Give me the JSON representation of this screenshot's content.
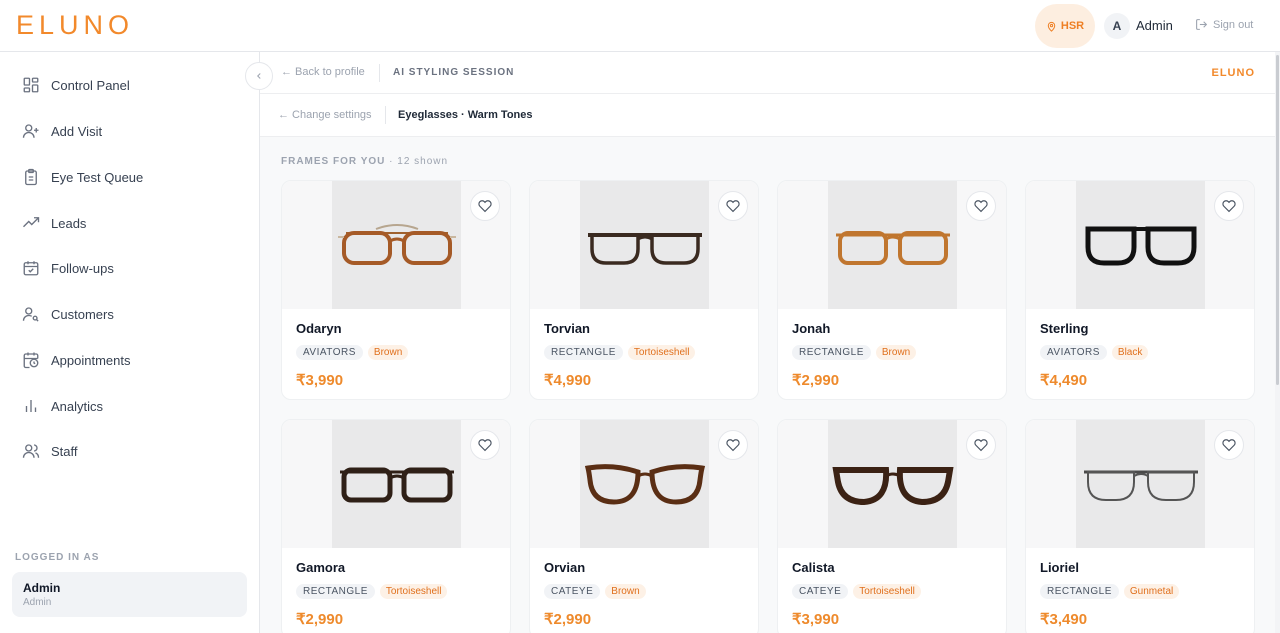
{
  "header": {
    "logo": "ELUNO",
    "location": "HSR",
    "avatar_initial": "A",
    "admin_name": "Admin",
    "signout": "Sign out"
  },
  "sidebar": {
    "items": [
      {
        "label": "Control Panel",
        "icon": "grid-icon"
      },
      {
        "label": "Add Visit",
        "icon": "user-plus-icon"
      },
      {
        "label": "Eye Test Queue",
        "icon": "clipboard-icon"
      },
      {
        "label": "Leads",
        "icon": "trending-up-icon"
      },
      {
        "label": "Follow-ups",
        "icon": "calendar-check-icon"
      },
      {
        "label": "Customers",
        "icon": "user-search-icon"
      },
      {
        "label": "Appointments",
        "icon": "calendar-clock-icon"
      },
      {
        "label": "Analytics",
        "icon": "bar-chart-icon"
      },
      {
        "label": "Staff",
        "icon": "users-icon"
      }
    ],
    "logged_in_label": "LOGGED IN AS",
    "user_name": "Admin",
    "user_role": "Admin"
  },
  "session": {
    "back": "← Back to profile",
    "title": "AI STYLING SESSION",
    "brand": "ELUNO",
    "change": "← Change settings",
    "settings": "Eyeglasses · Warm Tones"
  },
  "section": {
    "title": "FRAMES FOR YOU",
    "count": "· 12 shown"
  },
  "colors": {
    "accent": "#f2892b",
    "price": "#ee8a2c",
    "tag_color_bg": "#fdf1e6"
  },
  "frames": [
    {
      "name": "Odaryn",
      "shape": "AVIATORS",
      "color": "Brown",
      "price": "₹3,990"
    },
    {
      "name": "Torvian",
      "shape": "RECTANGLE",
      "color": "Tortoiseshell",
      "price": "₹4,990"
    },
    {
      "name": "Jonah",
      "shape": "RECTANGLE",
      "color": "Brown",
      "price": "₹2,990"
    },
    {
      "name": "Sterling",
      "shape": "AVIATORS",
      "color": "Black",
      "price": "₹4,490"
    },
    {
      "name": "Gamora",
      "shape": "RECTANGLE",
      "color": "Tortoiseshell",
      "price": "₹2,990"
    },
    {
      "name": "Orvian",
      "shape": "CATEYE",
      "color": "Brown",
      "price": "₹2,990"
    },
    {
      "name": "Calista",
      "shape": "CATEYE",
      "color": "Tortoiseshell",
      "price": "₹3,990"
    },
    {
      "name": "Lioriel",
      "shape": "RECTANGLE",
      "color": "Gunmetal",
      "price": "₹3,490"
    }
  ]
}
